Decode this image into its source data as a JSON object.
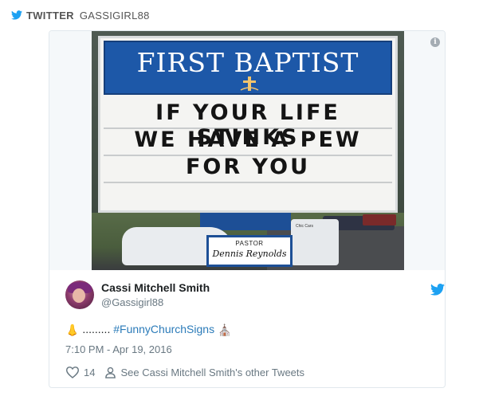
{
  "source": {
    "platform": "TWITTER",
    "handle": "GASSIGIRL88",
    "icon": "twitter-bird-icon"
  },
  "embed": {
    "info_icon": "info-icon",
    "photo": {
      "sign_title": "FIRST BAPTIST",
      "sign_lines": [
        "IF YOUR LIFE STINKS",
        "WE HAVE A PEW",
        "FOR YOU"
      ],
      "pastor_label": "PASTOR",
      "pastor_name": "Dennis Reynolds",
      "car_text": "Chic Cars"
    },
    "author": {
      "name": "Cassi Mitchell Smith",
      "screen_name": "@Gassigirl88",
      "avatar": "avatar"
    },
    "tweet": {
      "emoji_before": "👃",
      "dots": ".........",
      "hashtag": "#FunnyChurchSigns",
      "emoji_after": "⛪"
    },
    "timestamp": "7:10 PM - Apr 19, 2016",
    "actions": {
      "like_count": "14",
      "profile_link": "See Cassi Mitchell Smith's other Tweets"
    }
  },
  "colors": {
    "twitter_blue": "#1da1f2",
    "link_blue": "#2b7bb9",
    "sign_blue": "#1d58a8",
    "muted_text": "#697882"
  }
}
